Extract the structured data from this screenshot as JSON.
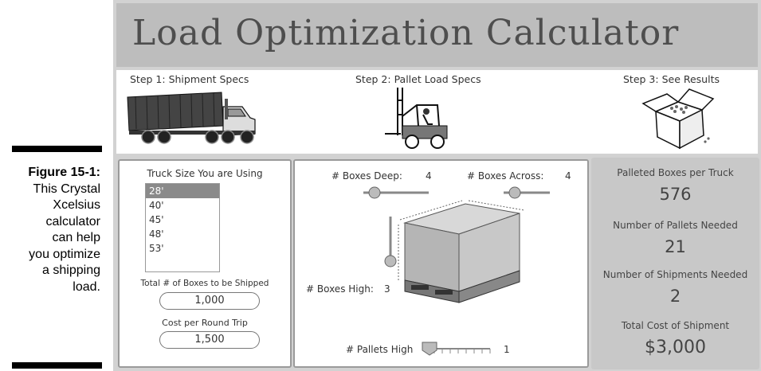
{
  "caption": {
    "figure": "Figure 15-1:",
    "lines": [
      "This Crystal",
      "Xcelsius",
      "calculator",
      "can help",
      "you optimize",
      "a shipping",
      "load."
    ]
  },
  "app": {
    "title": "Load Optimization Calculator"
  },
  "steps": [
    {
      "label": "Step 1:  Shipment Specs",
      "icon": "truck-icon"
    },
    {
      "label": "Step 2:  Pallet Load Specs",
      "icon": "forklift-icon"
    },
    {
      "label": "Step 3:  See Results",
      "icon": "open-box-icon"
    }
  ],
  "truck_size": {
    "label": "Truck Size You are Using",
    "options": [
      "28'",
      "40'",
      "45'",
      "48'",
      "53'"
    ],
    "selected": "28'"
  },
  "boxes_total": {
    "label": "Total # of Boxes to be Shipped",
    "value": "1,000"
  },
  "round_trip": {
    "label": "Cost per Round Trip",
    "value": "1,500"
  },
  "pallet": {
    "deep": {
      "label": "# Boxes Deep:",
      "value": "4"
    },
    "across": {
      "label": "# Boxes Across:",
      "value": "4"
    },
    "high": {
      "label": "# Boxes High:",
      "value": "3"
    },
    "pallets_high": {
      "label": "# Pallets High",
      "value": "1"
    }
  },
  "results": [
    {
      "label": "Palleted Boxes per Truck",
      "value": "576"
    },
    {
      "label": "Number of Pallets Needed",
      "value": "21"
    },
    {
      "label": "Number of Shipments Needed",
      "value": "2"
    },
    {
      "label": "Total Cost of Shipment",
      "value": "$3,000"
    }
  ]
}
